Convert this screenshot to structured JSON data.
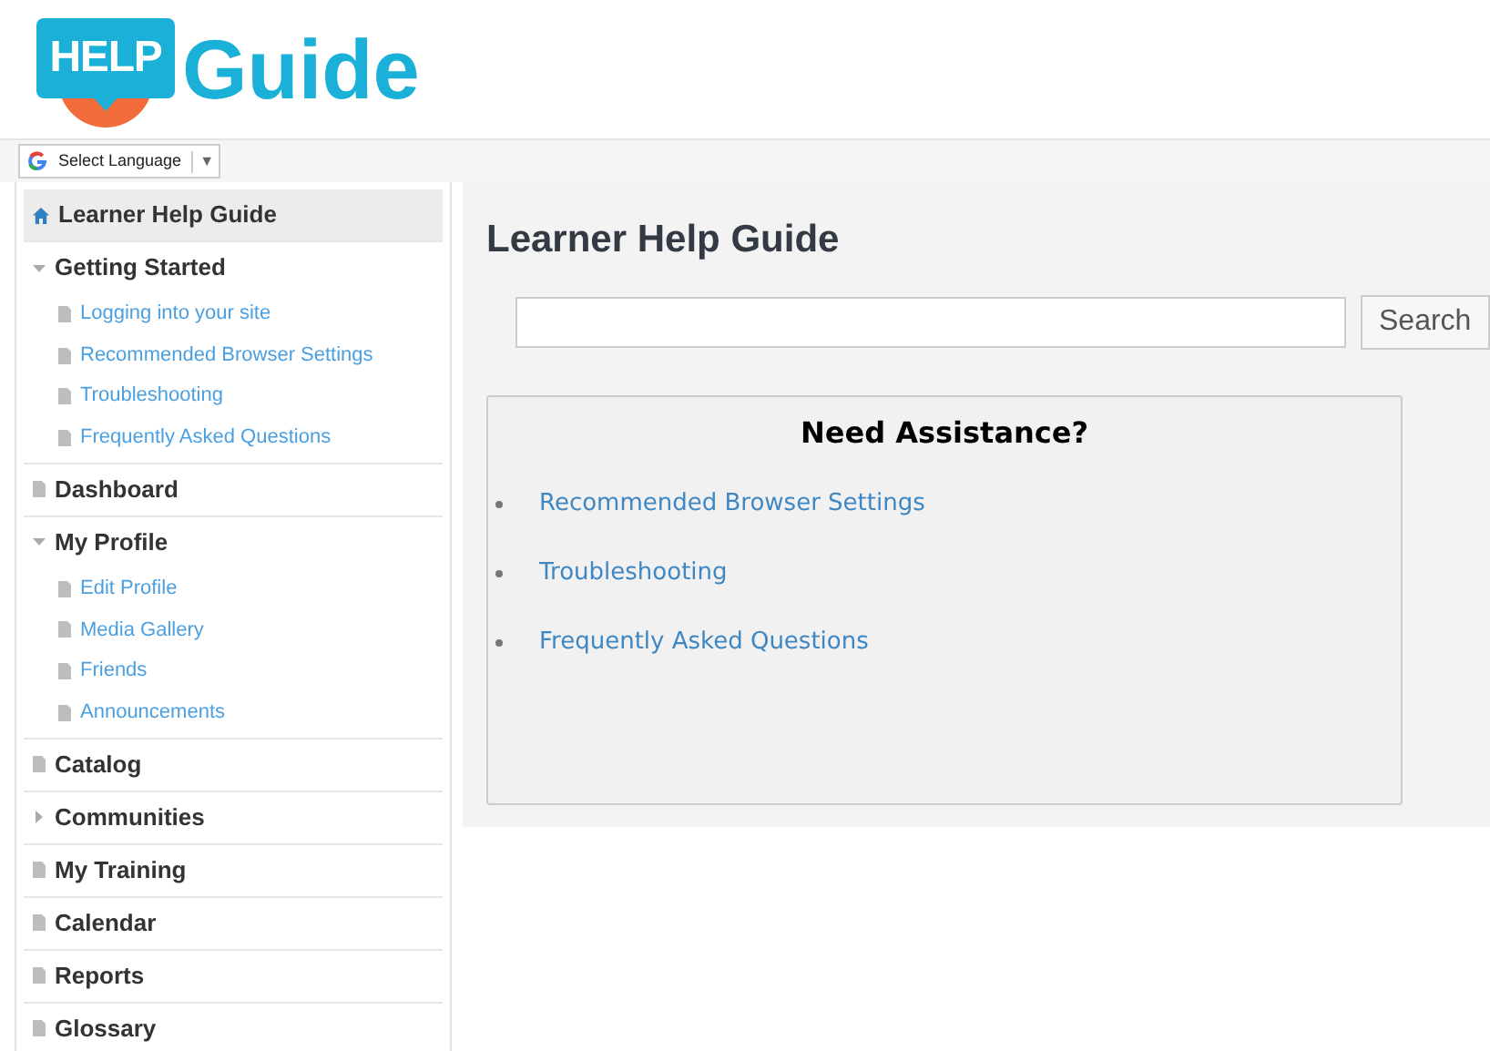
{
  "logo": {
    "badge": "HELP",
    "wordmark": "Guide"
  },
  "language_selector": {
    "label": "Select Language",
    "caret": "▼"
  },
  "sidebar": {
    "items": [
      {
        "kind": "home",
        "label": "Learner Help Guide",
        "selected": true
      },
      {
        "kind": "folder",
        "label": "Getting Started",
        "expanded": true,
        "selected": false,
        "children": [
          {
            "label": "Logging into your site"
          },
          {
            "label": "Recommended Browser Settings"
          },
          {
            "label": "Troubleshooting"
          },
          {
            "label": "Frequently Asked Questions"
          }
        ]
      },
      {
        "kind": "page",
        "label": "Dashboard",
        "selected": false
      },
      {
        "kind": "folder",
        "label": "My Profile",
        "expanded": true,
        "selected": false,
        "children": [
          {
            "label": "Edit Profile"
          },
          {
            "label": "Media Gallery"
          },
          {
            "label": "Friends"
          },
          {
            "label": "Announcements"
          }
        ]
      },
      {
        "kind": "page",
        "label": "Catalog",
        "selected": false
      },
      {
        "kind": "folder",
        "label": "Communities",
        "expanded": false,
        "selected": false
      },
      {
        "kind": "page",
        "label": "My Training",
        "selected": false
      },
      {
        "kind": "page",
        "label": "Calendar",
        "selected": false
      },
      {
        "kind": "page",
        "label": "Reports",
        "selected": false
      },
      {
        "kind": "page",
        "label": "Glossary",
        "selected": false
      }
    ]
  },
  "main": {
    "title": "Learner Help Guide",
    "search": {
      "button": "Search"
    },
    "assistance": {
      "title": "Need Assistance?",
      "links": [
        "Recommended Browser Settings",
        "Troubleshooting",
        "Frequently Asked Questions"
      ]
    }
  }
}
